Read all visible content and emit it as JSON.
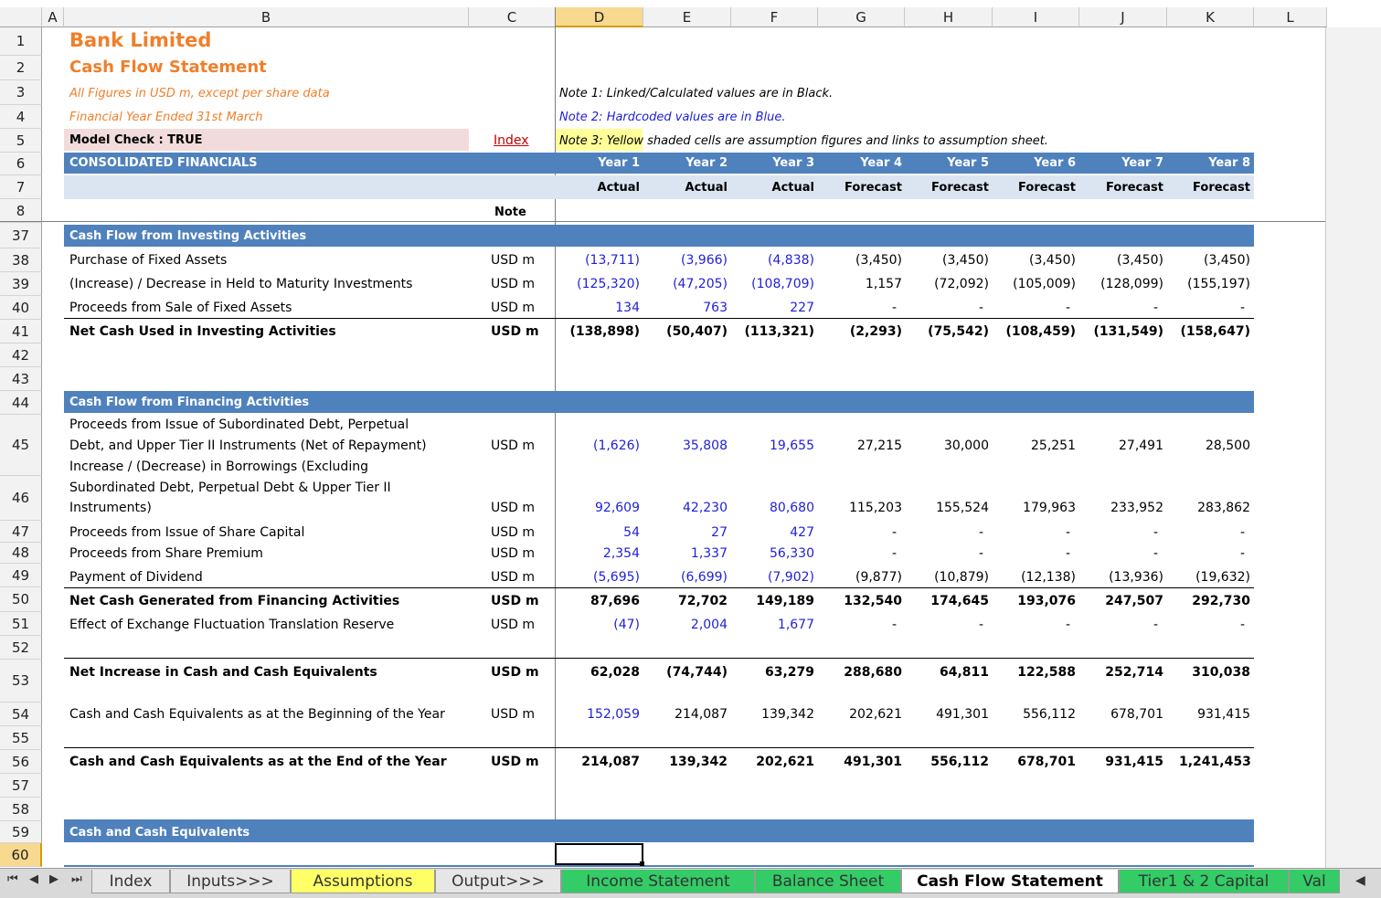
{
  "columns": [
    "A",
    "B",
    "C",
    "D",
    "E",
    "F",
    "G",
    "H",
    "I",
    "J",
    "K",
    "L"
  ],
  "row_numbers": [
    "1",
    "2",
    "3",
    "4",
    "5",
    "6",
    "7",
    "8",
    "37",
    "38",
    "39",
    "40",
    "41",
    "42",
    "43",
    "44",
    "45",
    "46",
    "47",
    "48",
    "49",
    "50",
    "51",
    "52",
    "53",
    "54",
    "55",
    "56",
    "57",
    "58",
    "59",
    "60"
  ],
  "header": {
    "company": "Bank Limited",
    "statement": "Cash Flow Statement",
    "figures_note": "All Figures in USD m, except per share data",
    "year_note": "Financial Year Ended 31st March",
    "model_check": "Model Check : TRUE",
    "index_link": "Index",
    "note1": "Note 1: Linked/Calculated values are in Black.",
    "note2": "Note 2: Hardcoded values are in Blue.",
    "note3_a": "Note 3: Yellow",
    "note3_b": " shaded cells are assumption figures and links to assumption sheet."
  },
  "consolidated": "CONSOLIDATED FINANCIALS",
  "years": [
    "Year 1",
    "Year 2",
    "Year 3",
    "Year 4",
    "Year 5",
    "Year 6",
    "Year 7",
    "Year 8"
  ],
  "status": [
    "Actual",
    "Actual",
    "Actual",
    "Forecast",
    "Forecast",
    "Forecast",
    "Forecast",
    "Forecast"
  ],
  "note_header": "Note",
  "sections": {
    "investing": "Cash Flow from Investing Activities",
    "financing": "Cash Flow from Financing Activities",
    "cash_eq": "Cash and Cash Equivalents"
  },
  "rows": {
    "r38": {
      "label": "Purchase of Fixed Assets",
      "unit": "USD m",
      "values": [
        "(13,711)",
        "(3,966)",
        "(4,838)",
        "(3,450)",
        "(3,450)",
        "(3,450)",
        "(3,450)",
        "(3,450)"
      ]
    },
    "r39": {
      "label": "(Increase) / Decrease in Held to Maturity Investments",
      "unit": "USD m",
      "values": [
        "(125,320)",
        "(47,205)",
        "(108,709)",
        "1,157",
        "(72,092)",
        "(105,009)",
        "(128,099)",
        "(155,197)"
      ]
    },
    "r40": {
      "label": "Proceeds from Sale of Fixed Assets",
      "unit": "USD m",
      "values": [
        "134",
        "763",
        "227",
        "-",
        "-",
        "-",
        "-",
        "-"
      ]
    },
    "r41": {
      "label": "Net Cash Used in Investing Activities",
      "unit": "USD m",
      "values": [
        "(138,898)",
        "(50,407)",
        "(113,321)",
        "(2,293)",
        "(75,542)",
        "(108,459)",
        "(131,549)",
        "(158,647)"
      ]
    },
    "r45": {
      "label1": "Proceeds from Issue of Subordinated Debt, Perpetual",
      "label2": "Debt, and Upper Tier II Instruments (Net of Repayment)",
      "unit": "USD m",
      "values": [
        "(1,626)",
        "35,808",
        "19,655",
        "27,215",
        "30,000",
        "25,251",
        "27,491",
        "28,500"
      ]
    },
    "r46": {
      "label1": "Increase / (Decrease) in Borrowings (Excluding",
      "label2": "Subordinated Debt, Perpetual Debt & Upper Tier II",
      "label3": "Instruments)",
      "unit": "USD m",
      "values": [
        "92,609",
        "42,230",
        "80,680",
        "115,203",
        "155,524",
        "179,963",
        "233,952",
        "283,862"
      ]
    },
    "r47": {
      "label": "Proceeds from Issue of Share Capital",
      "unit": "USD m",
      "values": [
        "54",
        "27",
        "427",
        "-",
        "-",
        "-",
        "-",
        "-"
      ]
    },
    "r48": {
      "label": "Proceeds from Share Premium",
      "unit": "USD m",
      "values": [
        "2,354",
        "1,337",
        "56,330",
        "-",
        "-",
        "-",
        "-",
        "-"
      ]
    },
    "r49": {
      "label": "Payment of Dividend",
      "unit": "USD m",
      "values": [
        "(5,695)",
        "(6,699)",
        "(7,902)",
        "(9,877)",
        "(10,879)",
        "(12,138)",
        "(13,936)",
        "(19,632)"
      ]
    },
    "r50": {
      "label": "Net Cash Generated from Financing Activities",
      "unit": "USD m",
      "values": [
        "87,696",
        "72,702",
        "149,189",
        "132,540",
        "174,645",
        "193,076",
        "247,507",
        "292,730"
      ]
    },
    "r51": {
      "label": "Effect of Exchange Fluctuation Translation Reserve",
      "unit": "USD m",
      "values": [
        "(47)",
        "2,004",
        "1,677",
        "-",
        "-",
        "-",
        "-",
        "-"
      ]
    },
    "r53": {
      "label": "Net Increase in Cash and Cash Equivalents",
      "unit": "USD m",
      "values": [
        "62,028",
        "(74,744)",
        "63,279",
        "288,680",
        "64,811",
        "122,588",
        "252,714",
        "310,038"
      ]
    },
    "r54": {
      "label": "Cash and Cash Equivalents as at the Beginning of the Year",
      "unit": "USD m",
      "values": [
        "152,059",
        "214,087",
        "139,342",
        "202,621",
        "491,301",
        "556,112",
        "678,701",
        "931,415"
      ]
    },
    "r56": {
      "label": "Cash and Cash Equivalents as at the End of the Year",
      "unit": "USD m",
      "values": [
        "214,087",
        "139,342",
        "202,621",
        "491,301",
        "556,112",
        "678,701",
        "931,415",
        "1,241,453"
      ]
    }
  },
  "tabs": [
    "Index",
    "Inputs>>>",
    "Assumptions",
    "Output>>>",
    "Income Statement",
    "Balance Sheet",
    "Cash Flow Statement",
    "Tier1 & 2 Capital",
    "Val"
  ],
  "nav_glyphs": [
    "⏮",
    "◀",
    "▶",
    "⏭"
  ]
}
